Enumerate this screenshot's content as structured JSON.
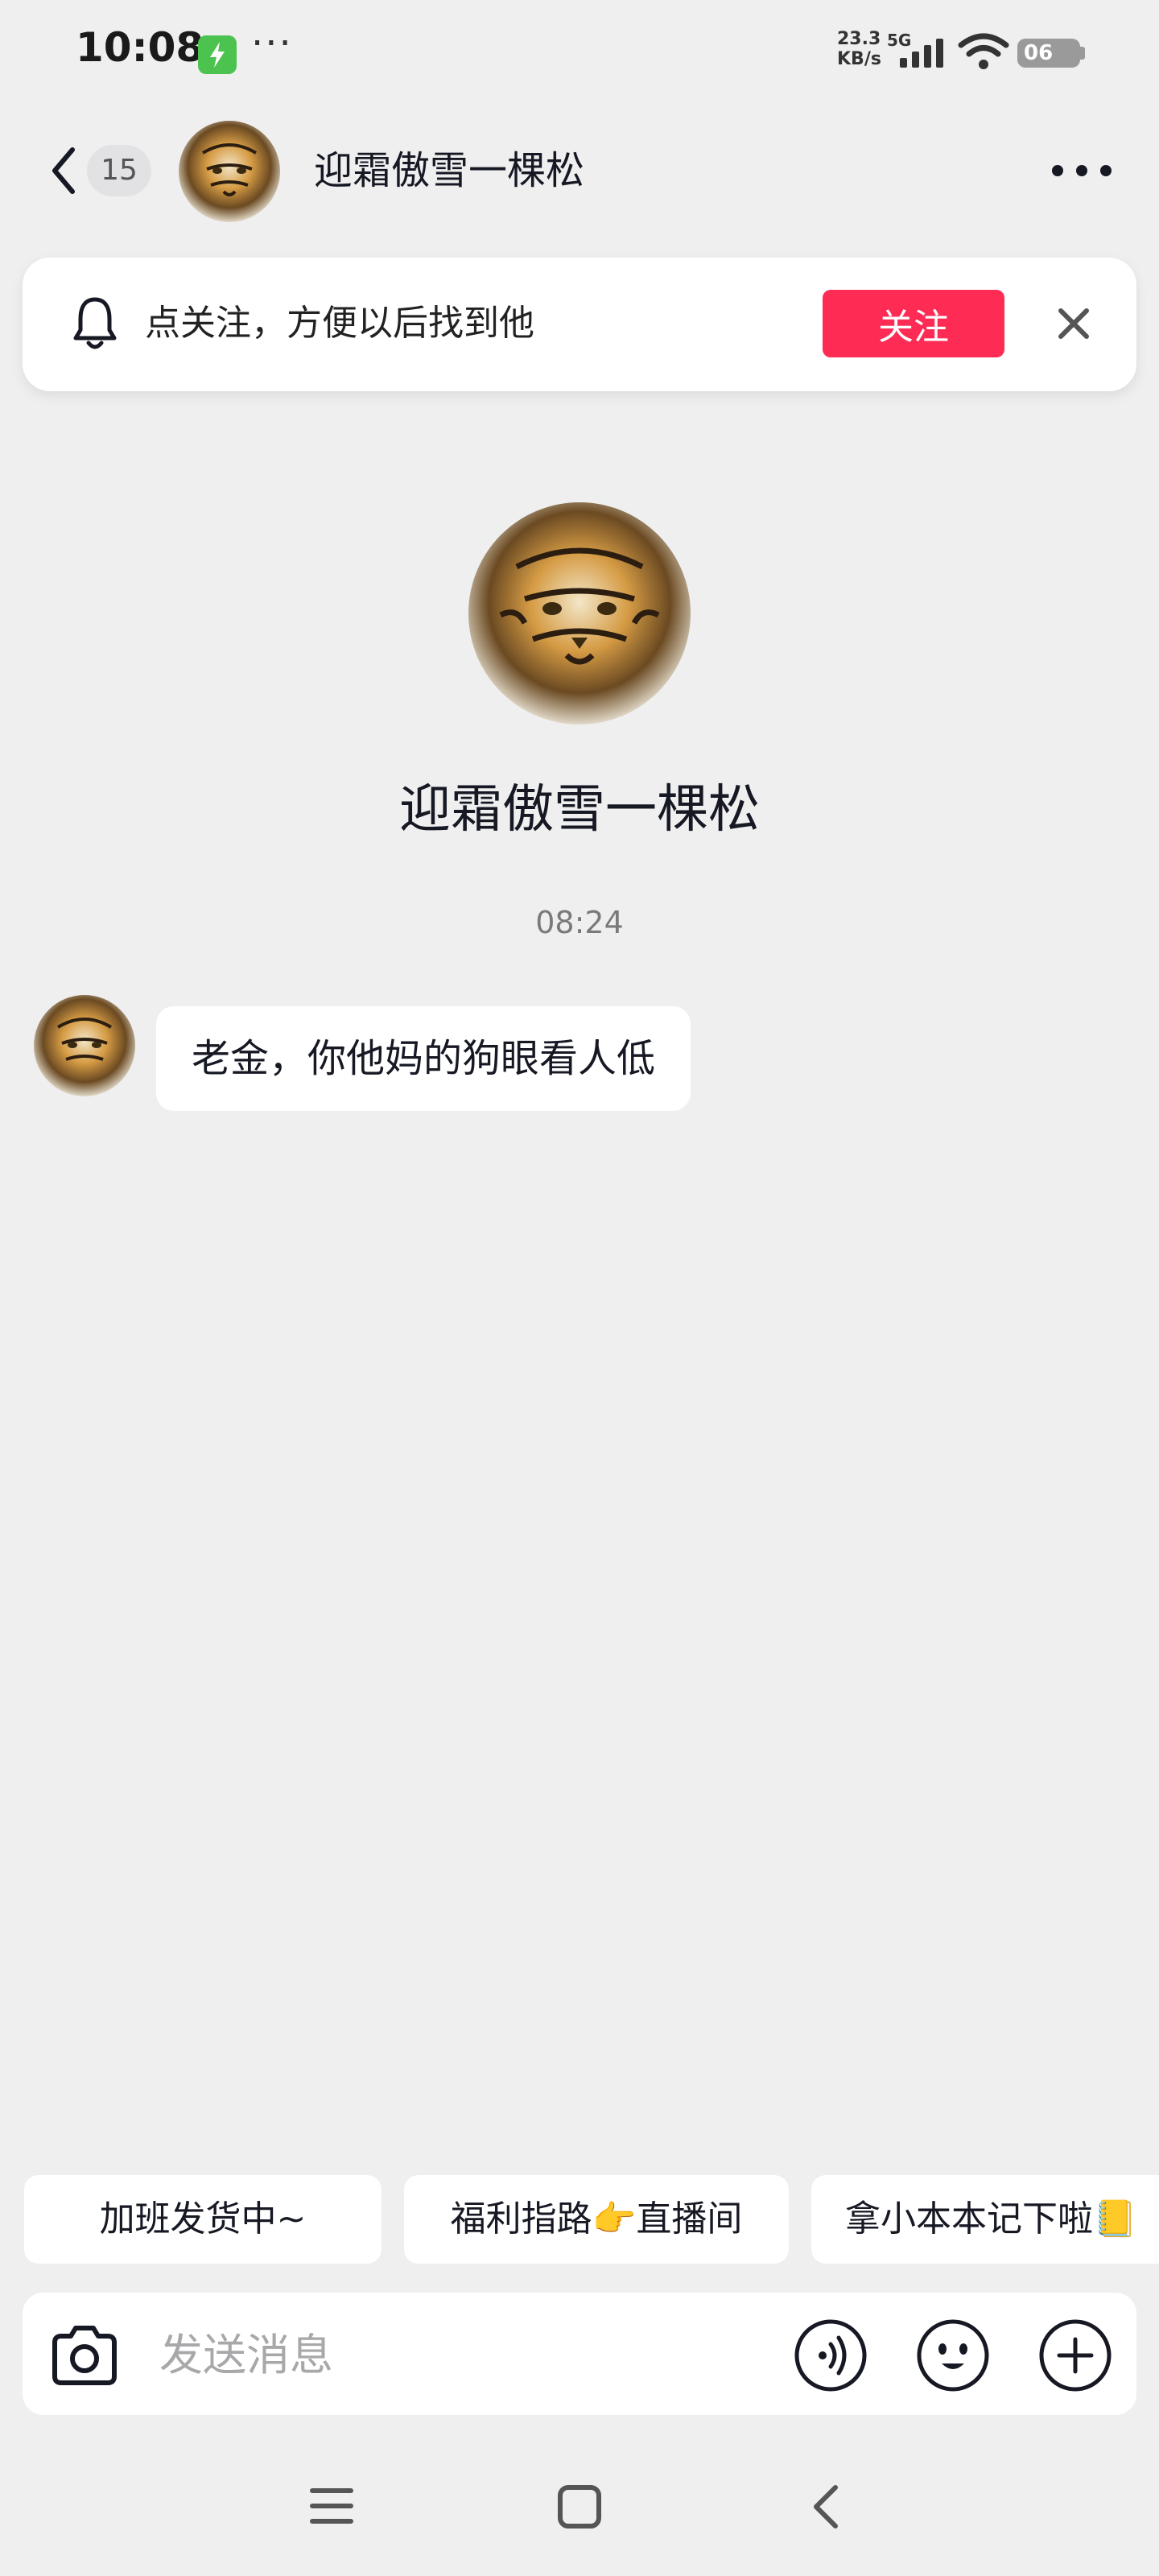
{
  "status_bar": {
    "time": "10:08",
    "dots": "···",
    "net_speed_value": "23.3",
    "net_speed_unit": "KB/s",
    "network": "5G",
    "battery": "06"
  },
  "header": {
    "unread_count": "15",
    "title": "迎霜傲雪一棵松"
  },
  "follow_banner": {
    "tip": "点关注，方便以后找到他",
    "follow_label": "关注"
  },
  "profile": {
    "name": "迎霜傲雪一棵松"
  },
  "chat": {
    "timestamp": "08:24",
    "messages": [
      {
        "text": "老金，你他妈的狗眼看人低"
      }
    ]
  },
  "quick_replies": [
    {
      "label": "加班发货中~"
    },
    {
      "label": "福利指路👉直播间"
    },
    {
      "label": "拿小本本记下啦📒"
    }
  ],
  "input": {
    "placeholder": "发送消息"
  },
  "colors": {
    "background": "#efeff0",
    "accent": "#fe2c55",
    "charge": "#4cc34f"
  }
}
